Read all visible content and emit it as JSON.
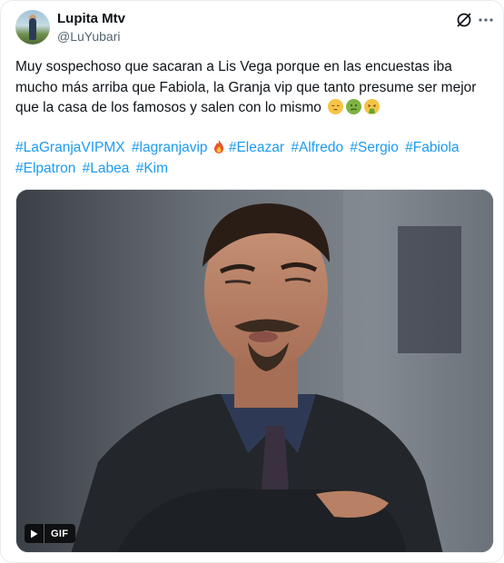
{
  "author": {
    "name": "Lupita Mtv",
    "handle": "@LuYubari"
  },
  "tweet": {
    "text": "Muy sospechoso que sacaran a Lis Vega porque en las encuestas iba mucho más arriba que Fabiola, la Granja vip que tanto presume ser mejor que la casa de los famosos y salen con lo mismo",
    "emojis": [
      "pensive-face-icon",
      "nauseated-face-icon",
      "vomiting-face-icon"
    ],
    "hashtags": [
      "#LaGranjaVIPMX",
      "#lagranjavip",
      "#Eleazar",
      "#Alfredo",
      "#Sergio",
      "#Fabiola",
      "#Elpatron",
      "#Labea",
      "#Kim"
    ],
    "media_badge": "GIF"
  },
  "colors": {
    "link": "#1d9bf0",
    "text": "#0f1419",
    "secondary": "#536471"
  }
}
